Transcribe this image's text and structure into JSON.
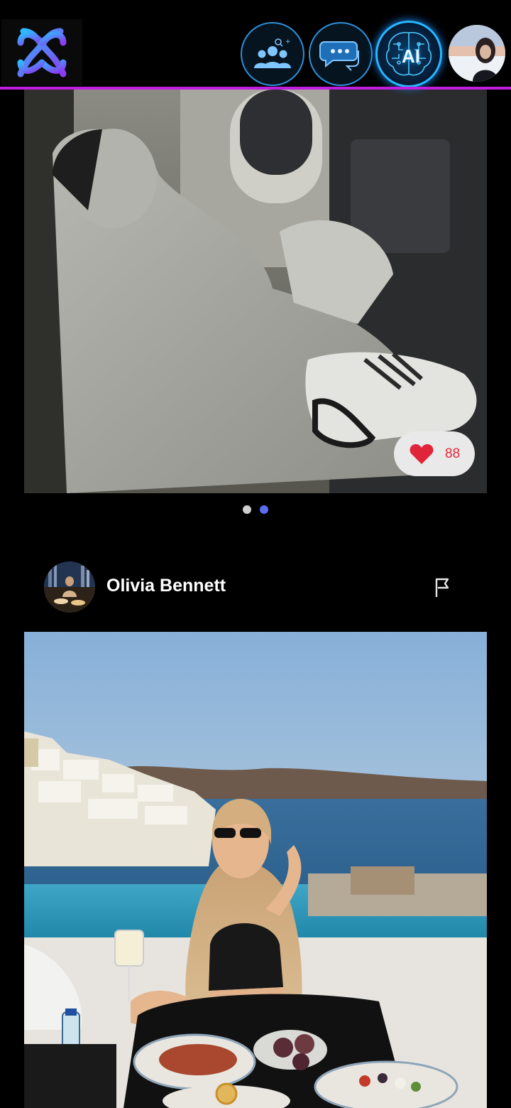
{
  "header": {
    "logo_icon": "app-logo-icon",
    "groups_icon": "people-search-icon",
    "chat_icon": "chat-bubbles-icon",
    "ai_label": "AI",
    "accent_line_color": "#c21ce0"
  },
  "post1": {
    "likes": "88",
    "carousel_dots": 2,
    "active_dot": 2
  },
  "post2": {
    "author": "Olivia Bennett",
    "flag_icon": "flag-icon"
  }
}
